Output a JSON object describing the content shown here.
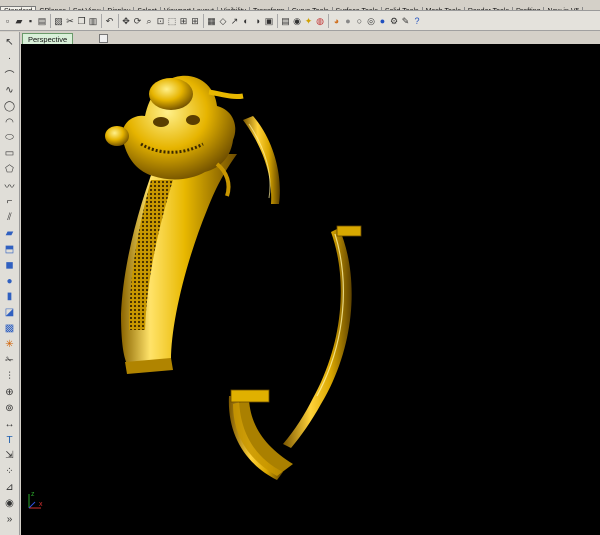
{
  "tabs": [
    "Standard",
    "CPlanes",
    "Set View",
    "Display",
    "Select",
    "Viewport Layout",
    "Visibility",
    "Transform",
    "Curve Tools",
    "Surface Tools",
    "Solid Tools",
    "Mesh Tools",
    "Render Tools",
    "Drafting",
    "New in V5"
  ],
  "active_tab": "Standard",
  "toolbar_icons": [
    "new-icon",
    "open-icon",
    "save-icon",
    "print-icon",
    "import-icon",
    "cut-icon",
    "copy-icon",
    "paste-icon",
    "undo-icon",
    "pan-icon",
    "rotate-view-icon",
    "zoom-dynamic-icon",
    "zoom-extents-icon",
    "zoom-window-icon",
    "zoom-selected-icon",
    "four-view-icon",
    "grid-icon",
    "cplane-icon",
    "select-icon",
    "show-icon",
    "hide-icon",
    "lock-icon",
    "layer-icon",
    "properties-icon",
    "light-icon",
    "render-icon",
    "material-icon",
    "sphere-shaded-icon",
    "sphere-icon",
    "environment-icon",
    "sphere-blue-icon",
    "options-icon",
    "tools-icon",
    "help-icon"
  ],
  "viewport": {
    "label": "Perspective",
    "background": "#000000"
  },
  "left_tool_icons": [
    "select-arrow-icon",
    "point-icon",
    "polyline-icon",
    "curve-icon",
    "circle-icon",
    "arc-icon",
    "ellipse-icon",
    "rectangle-icon",
    "polygon-icon",
    "freeform-icon",
    "fillet-curve-icon",
    "offset-icon",
    "surface-icon",
    "extrude-icon",
    "box-solid-icon",
    "sphere-solid-icon",
    "cylinder-solid-icon",
    "boolean-icon",
    "mesh-icon",
    "explode-icon",
    "trim-icon",
    "split-icon",
    "join-icon",
    "group-icon",
    "dimension-icon",
    "text-icon",
    "transform-icon",
    "array-icon",
    "analyze-icon",
    "render-sphere-icon",
    "more-icon"
  ],
  "axis_labels": {
    "z": "z",
    "x": "x"
  },
  "colors": {
    "gold_light": "#ffe066",
    "gold_mid": "#e0b400",
    "gold_dark": "#7a5600",
    "axis_green": "#2aa52a",
    "axis_red": "#d03030",
    "axis_blue": "#3050e0"
  }
}
